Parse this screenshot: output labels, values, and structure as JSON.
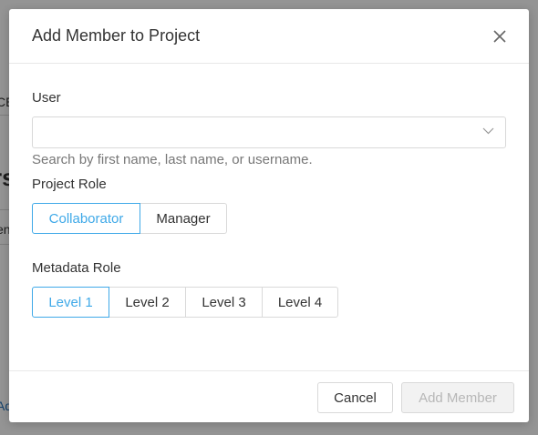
{
  "background": {
    "fragment_1": "CE",
    "fragment_2": "rs",
    "fragment_3": "en",
    "fragment_4": "Ad"
  },
  "modal": {
    "title": "Add Member to Project",
    "user": {
      "label": "User",
      "value": "",
      "help": "Search by first name, last name, or username."
    },
    "project_role": {
      "label": "Project Role",
      "options": [
        "Collaborator",
        "Manager"
      ],
      "selected": "Collaborator"
    },
    "metadata_role": {
      "label": "Metadata Role",
      "options": [
        "Level 1",
        "Level 2",
        "Level 3",
        "Level 4"
      ],
      "selected": "Level 1"
    },
    "footer": {
      "cancel_label": "Cancel",
      "add_label": "Add Member"
    }
  },
  "colors": {
    "accent": "#3fa9e8",
    "disabled_text": "#b7b7b7"
  },
  "icons": {
    "close": "close-icon",
    "dropdown": "chevron-down-icon"
  }
}
